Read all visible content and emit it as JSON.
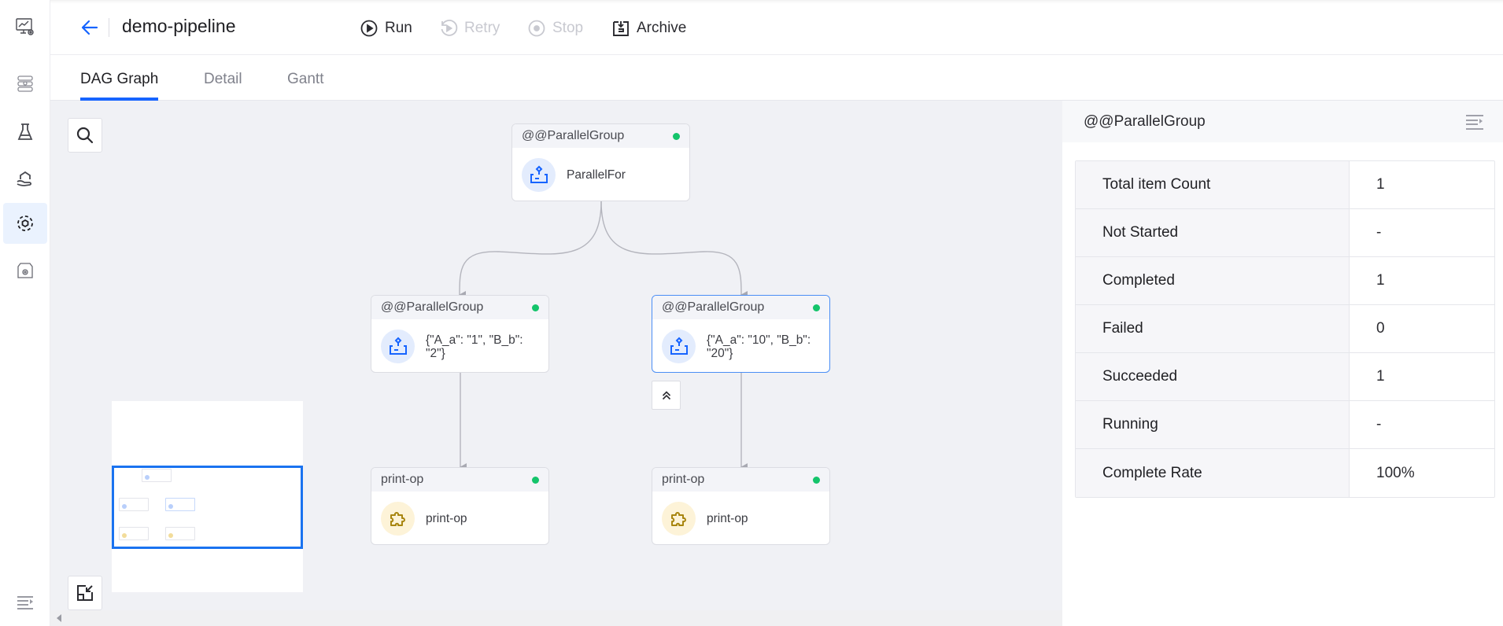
{
  "colors": {
    "accent": "#1664ff",
    "status_success": "#14c46b",
    "canvas_bg": "#f0f1f5",
    "selected_border": "#4a8ef5",
    "icon_blue_bg": "#e3ecfd",
    "icon_yellow_bg": "#fdf3d8"
  },
  "sidebar": {
    "items": [
      {
        "name": "monitor-settings",
        "icon": "monitor-gear-icon",
        "active": false
      },
      {
        "name": "data-source",
        "icon": "data-node-icon",
        "active": false
      },
      {
        "name": "experiments",
        "icon": "flask-icon",
        "active": false
      },
      {
        "name": "models",
        "icon": "hand-model-icon",
        "active": false
      },
      {
        "name": "pipelines",
        "icon": "pipeline-ring-icon",
        "active": true
      },
      {
        "name": "settings-storage",
        "icon": "box-gear-icon",
        "active": false
      }
    ],
    "collapse_icon": "menu-collapse-icon"
  },
  "header": {
    "back_icon": "arrow-left-icon",
    "title": "demo-pipeline",
    "actions": [
      {
        "label": "Run",
        "icon": "play-circle-icon",
        "disabled": false
      },
      {
        "label": "Retry",
        "icon": "retry-icon",
        "disabled": true
      },
      {
        "label": "Stop",
        "icon": "stop-circle-icon",
        "disabled": true
      },
      {
        "label": "Archive",
        "icon": "archive-icon",
        "disabled": false
      }
    ]
  },
  "tabs": [
    {
      "label": "DAG Graph",
      "active": true
    },
    {
      "label": "Detail",
      "active": false
    },
    {
      "label": "Gantt",
      "active": false
    }
  ],
  "graph": {
    "nodes": [
      {
        "id": "root",
        "header": "@@ParallelGroup",
        "label": "ParallelFor",
        "type": "parallel",
        "status": "succeeded",
        "selected": false
      },
      {
        "id": "group1",
        "header": "@@ParallelGroup",
        "label": "{\"A_a\": \"1\", \"B_b\": \"2\"}",
        "type": "parallel",
        "status": "succeeded",
        "selected": false
      },
      {
        "id": "group2",
        "header": "@@ParallelGroup",
        "label": "{\"A_a\": \"10\", \"B_b\": \"20\"}",
        "type": "parallel",
        "status": "succeeded",
        "selected": true
      },
      {
        "id": "op1",
        "header": "print-op",
        "label": "print-op",
        "type": "component",
        "status": "succeeded",
        "selected": false
      },
      {
        "id": "op2",
        "header": "print-op",
        "label": "print-op",
        "type": "component",
        "status": "succeeded",
        "selected": false
      }
    ],
    "edges": [
      {
        "from": "root",
        "to": "group1"
      },
      {
        "from": "root",
        "to": "group2"
      },
      {
        "from": "group1",
        "to": "op1"
      },
      {
        "from": "group2",
        "to": "op2"
      }
    ],
    "tools": {
      "search_icon": "search-icon",
      "fit_icon": "fit-view-icon",
      "collapse_icon": "double-chevron-up-icon"
    }
  },
  "panel": {
    "title": "@@ParallelGroup",
    "toggle_icon": "panel-collapse-icon",
    "stats": [
      {
        "key": "Total item Count",
        "value": "1"
      },
      {
        "key": "Not Started",
        "value": "-"
      },
      {
        "key": "Completed",
        "value": "1"
      },
      {
        "key": "Failed",
        "value": "0"
      },
      {
        "key": "Succeeded",
        "value": "1"
      },
      {
        "key": "Running",
        "value": "-"
      },
      {
        "key": "Complete Rate",
        "value": "100%"
      }
    ]
  }
}
